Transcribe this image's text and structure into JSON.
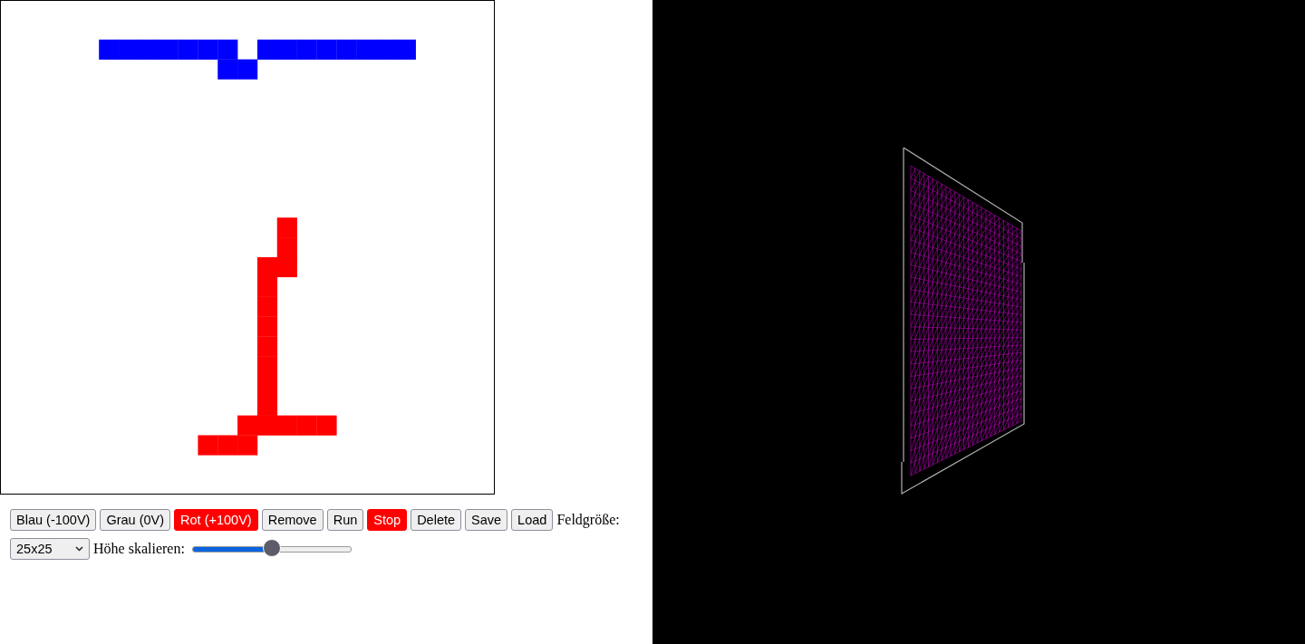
{
  "toolbar": {
    "buttons": [
      {
        "label": "Blau (-100V)",
        "highlighted": false
      },
      {
        "label": "Grau (0V)",
        "highlighted": false
      },
      {
        "label": "Rot (+100V)",
        "highlighted": true
      },
      {
        "label": "Remove",
        "highlighted": false
      },
      {
        "label": "Run",
        "highlighted": false
      },
      {
        "label": "Stop",
        "highlighted": true
      },
      {
        "label": "Delete",
        "highlighted": false
      },
      {
        "label": "Save",
        "highlighted": false
      },
      {
        "label": "Load",
        "highlighted": false
      }
    ],
    "field_size": {
      "label": "Feldgröße:",
      "value": "25x25"
    },
    "height_scale": {
      "label": "Höhe skalieren:",
      "level": 0.5
    }
  }
}
